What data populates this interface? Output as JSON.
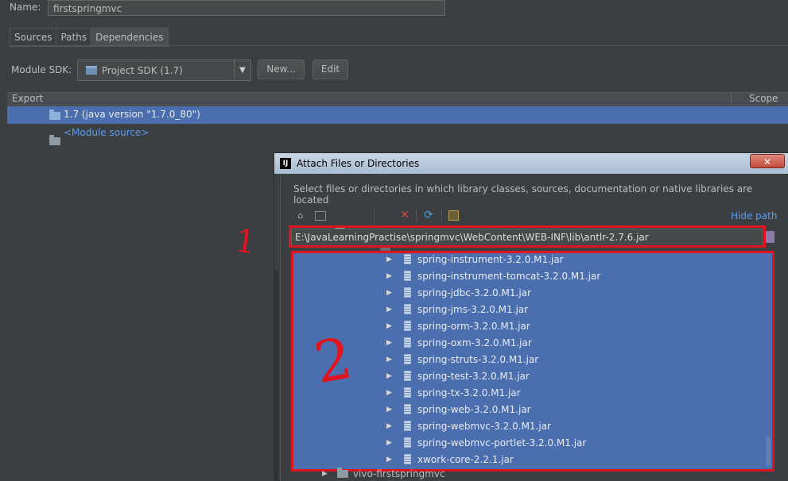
{
  "name_row": {
    "label": "Name:",
    "value": "firstspringmvc"
  },
  "tabs": [
    {
      "label": "Sources"
    },
    {
      "label": "Paths"
    },
    {
      "label": "Dependencies"
    }
  ],
  "sdk": {
    "label": "Module SDK:",
    "value": "Project SDK (1.7)",
    "new_label": "New...",
    "edit_label": "Edit"
  },
  "table": {
    "headers": {
      "export": "Export",
      "scope": "Scope"
    },
    "rows": [
      {
        "label": "1.7 (java version \"1.7.0_80\")",
        "selected": true
      },
      {
        "label": "<Module source>",
        "selected": false
      }
    ]
  },
  "dialog": {
    "title": "Attach Files or Directories",
    "logo": "IJ",
    "close_label": "✕",
    "description": "Select files or directories in which library classes, sources, documentation or native libraries are located",
    "hide_path_label": "Hide path",
    "path": "E:\\JavaLearningPractise\\springmvc\\WebContent\\WEB-INF\\lib\\antlr-2.7.6.jar",
    "toolbar_icons": [
      "home-icon",
      "desktop-icon",
      "new-folder-icon",
      "folder-icon",
      "folder-icon",
      "delete-icon",
      "refresh-icon",
      "show-hidden-icon"
    ],
    "files": [
      "spring-instrument-3.2.0.M1.jar",
      "spring-instrument-tomcat-3.2.0.M1.jar",
      "spring-jdbc-3.2.0.M1.jar",
      "spring-jms-3.2.0.M1.jar",
      "spring-orm-3.2.0.M1.jar",
      "spring-oxm-3.2.0.M1.jar",
      "spring-struts-3.2.0.M1.jar",
      "spring-test-3.2.0.M1.jar",
      "spring-tx-3.2.0.M1.jar",
      "spring-web-3.2.0.M1.jar",
      "spring-webmvc-3.2.0.M1.jar",
      "spring-webmvc-portlet-3.2.0.M1.jar",
      "xwork-core-2.2.1.jar"
    ],
    "tail_folder": "vivo-firstspringmvc"
  },
  "annotations": {
    "one": "1",
    "two": "2"
  },
  "colors": {
    "selection": "#4b6eaf",
    "annotation": "#e0141e",
    "link": "#589df6"
  }
}
